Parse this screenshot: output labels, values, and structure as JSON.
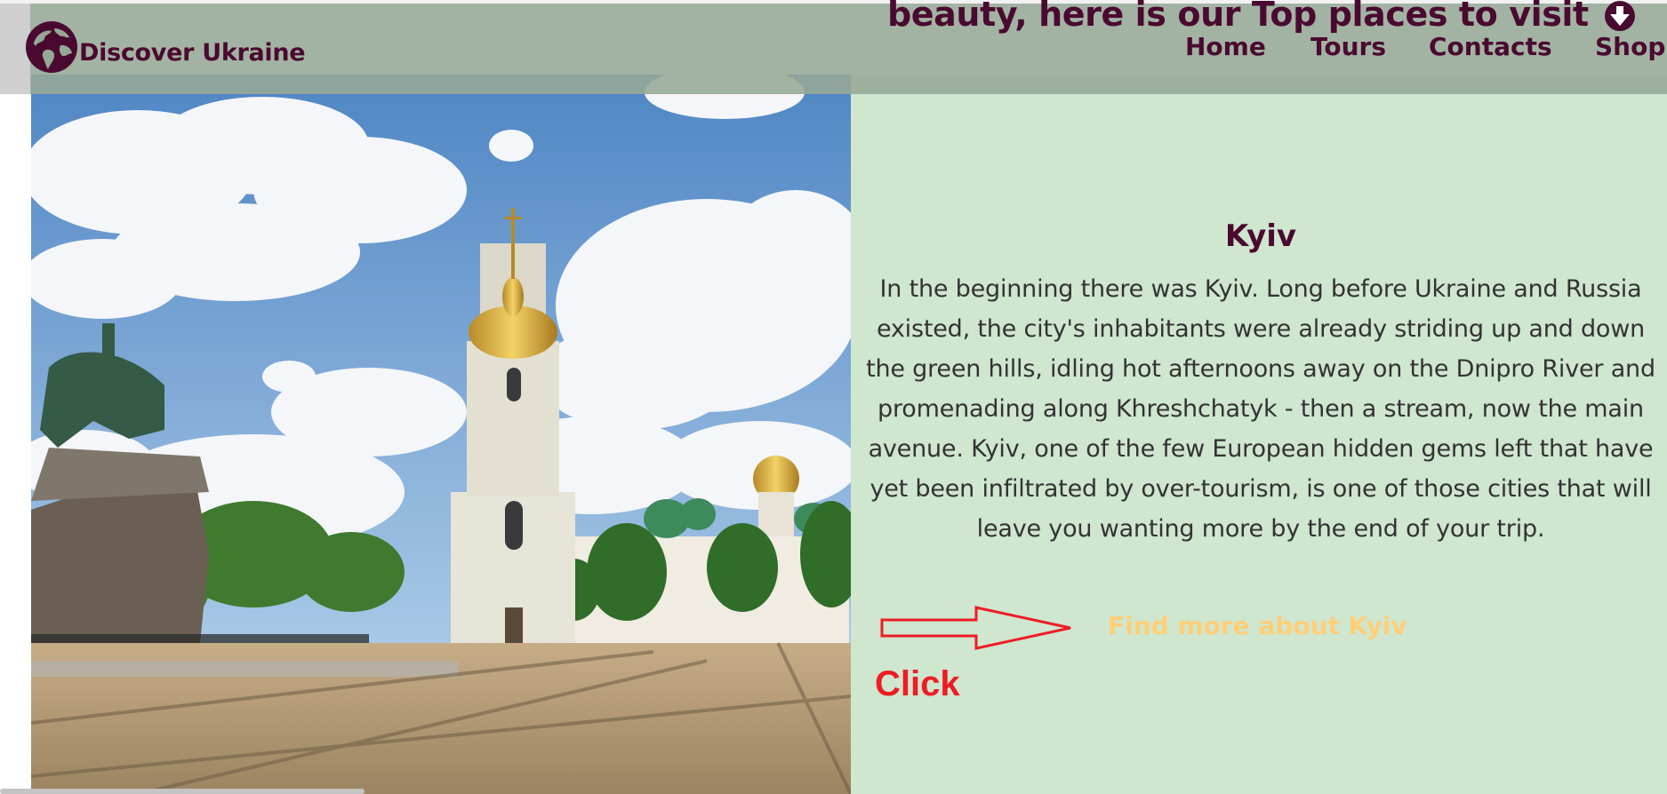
{
  "header": {
    "brand": "Discover Ukraine",
    "tagline": "beauty, here is our Top places to visit",
    "logo_icon": "globe-icon",
    "scroll_icon": "arrow-down-circle-icon"
  },
  "nav": [
    {
      "label": "Home"
    },
    {
      "label": "Tours"
    },
    {
      "label": "Contacts"
    },
    {
      "label": "Shop"
    }
  ],
  "place": {
    "title": "Kyiv",
    "description": "In the beginning there was Kyiv. Long before Ukraine and Russia existed, the city's inhabitants were already striding up and down the green hills, idling hot afternoons away on the Dnipro River and promenading along Khreshchatyk - then a stream, now the main avenue. Kyiv, one of the few European hidden gems left that have yet been infiltrated by over-tourism, is one of those cities that will leave you wanting more by the end of your trip.",
    "link_label": "Find more about Kyiv",
    "annotation": "Click"
  },
  "colors": {
    "brand": "#4a0a30",
    "header_bg": "#96a896",
    "panel_bg": "#cfe6cf",
    "link": "#ffcf78",
    "annotation": "#ee1c24"
  }
}
